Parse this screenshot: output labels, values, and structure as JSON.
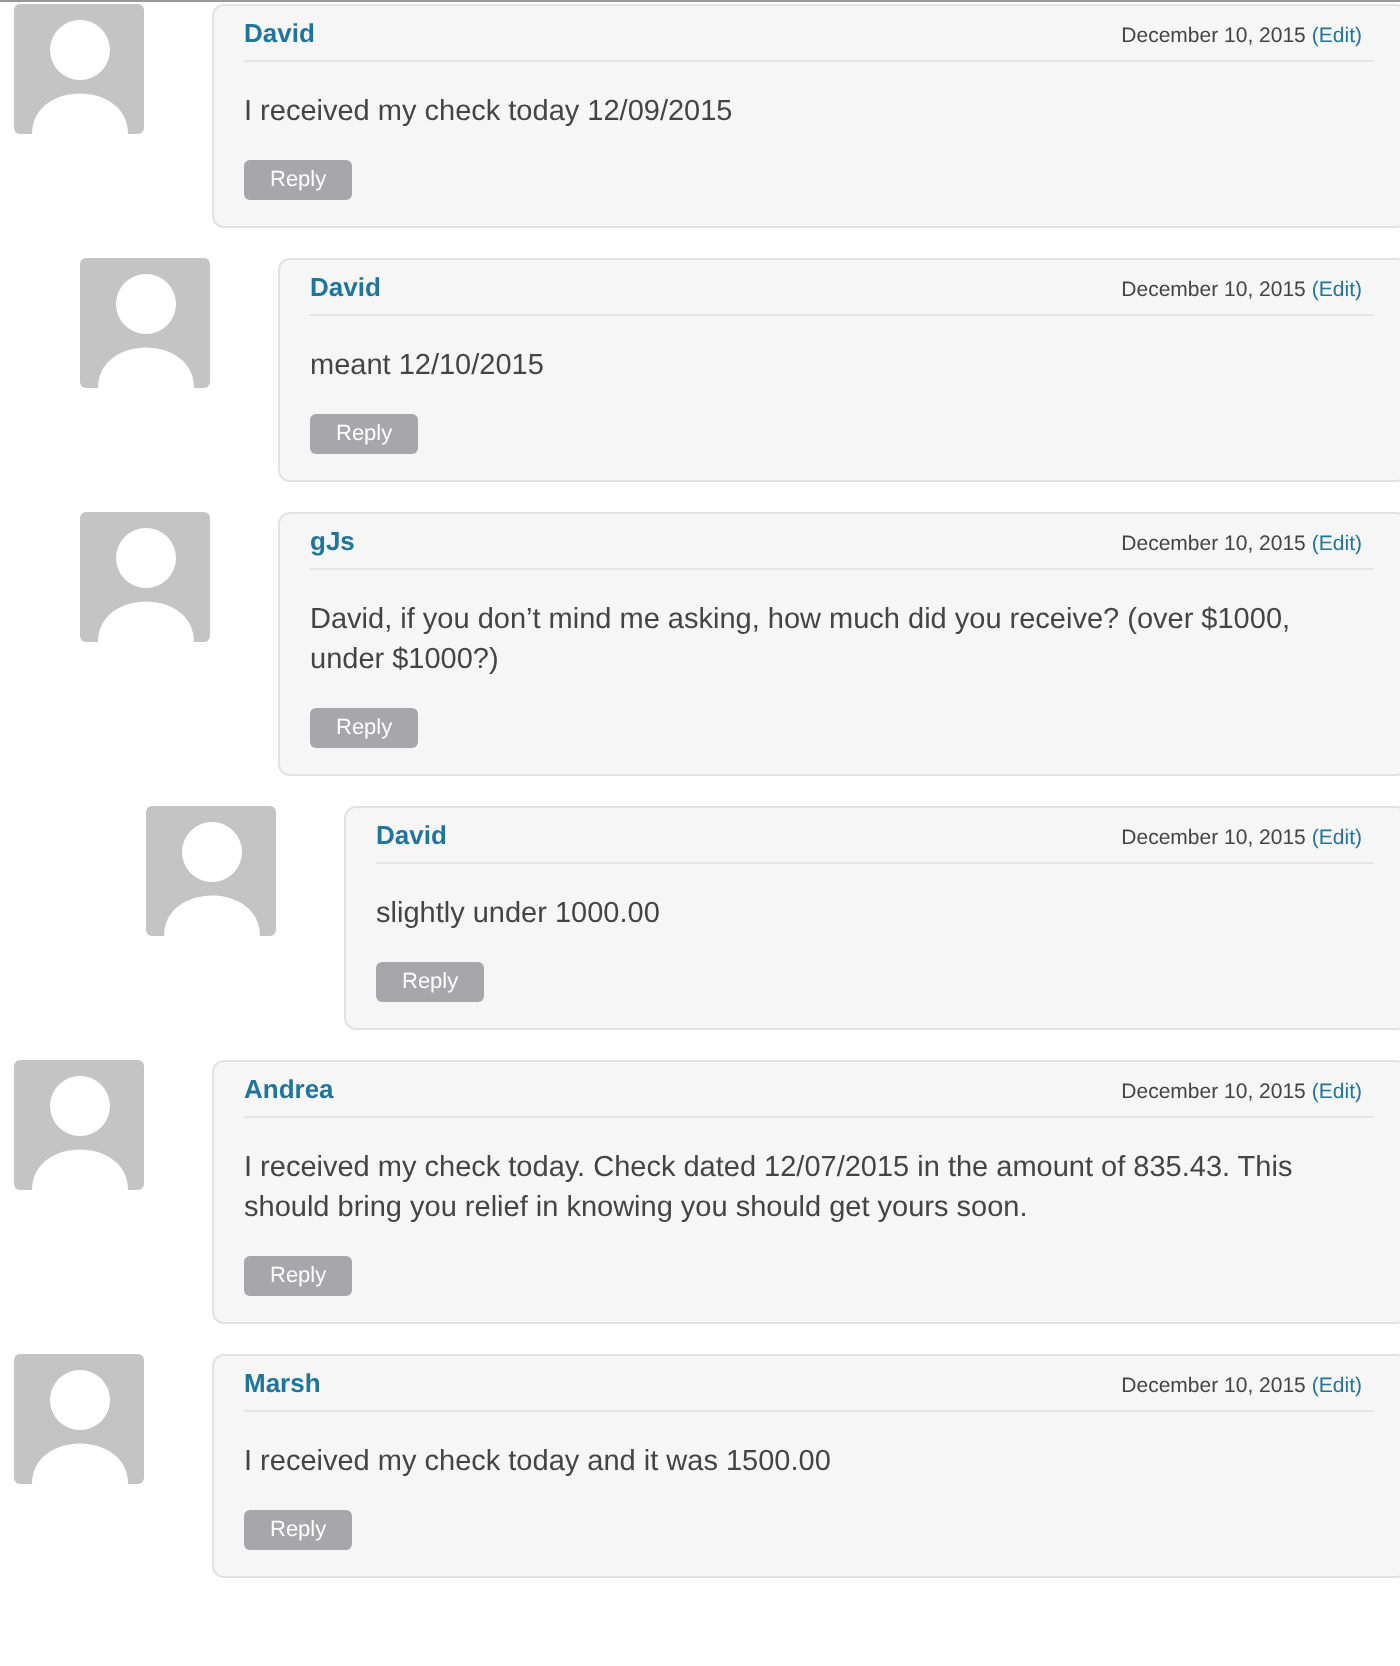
{
  "comments": [
    {
      "author": "David",
      "date": "December 10, 2015",
      "edit": "(Edit)",
      "text": "I received my check today 12/09/2015",
      "reply": "Reply",
      "children": [
        {
          "author": "David",
          "date": "December 10, 2015",
          "edit": "(Edit)",
          "text": "meant 12/10/2015",
          "reply": "Reply"
        },
        {
          "author": "gJs",
          "date": "December 10, 2015",
          "edit": "(Edit)",
          "text": "David, if you don’t mind me asking, how much did you receive? (over $1000, under $1000?)",
          "reply": "Reply",
          "children": [
            {
              "author": "David",
              "date": "December 10, 2015",
              "edit": "(Edit)",
              "text": "slightly under 1000.00",
              "reply": "Reply"
            }
          ]
        }
      ]
    },
    {
      "author": "Andrea",
      "date": "December 10, 2015",
      "edit": "(Edit)",
      "text": "I received my check today. Check dated 12/07/2015 in the amount of 835.43. This should bring you relief in knowing you should get yours soon.",
      "reply": "Reply"
    },
    {
      "author": "Marsh",
      "date": "December 10, 2015",
      "edit": "(Edit)",
      "text": "I received my check today and it was 1500.00",
      "reply": "Reply"
    }
  ]
}
